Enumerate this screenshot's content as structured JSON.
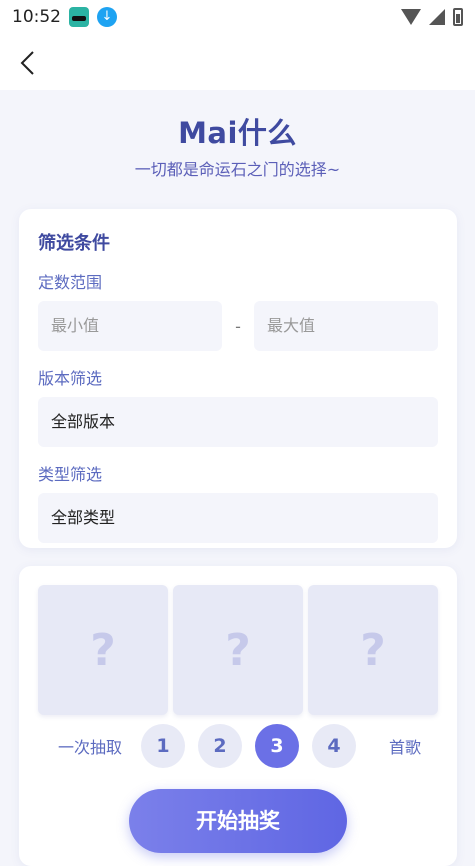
{
  "status_bar": {
    "time": "10:52",
    "icons": [
      "app-icon",
      "download-icon",
      "wifi-icon",
      "signal-icon",
      "battery-icon"
    ]
  },
  "nav": {
    "back_icon": "chevron-left-icon"
  },
  "header": {
    "title": "Mai什么",
    "subtitle": "一切都是命运石之门的选择~"
  },
  "filters": {
    "title": "筛选条件",
    "range_label": "定数范围",
    "min_placeholder": "最小值",
    "separator": "-",
    "max_placeholder": "最大值",
    "version_label": "版本筛选",
    "version_value": "全部版本",
    "type_label": "类型筛选",
    "type_value": "全部类型"
  },
  "draw": {
    "slots": [
      "?",
      "?",
      "?"
    ],
    "count_label": "一次抽取",
    "counts": [
      "1",
      "2",
      "3",
      "4"
    ],
    "selected_count": "3",
    "suffix_label": "首歌",
    "start_button": "开始抽奖"
  },
  "colors": {
    "accent": "#6b70e6",
    "title": "#3f4aa0",
    "label": "#5c6bc0"
  }
}
